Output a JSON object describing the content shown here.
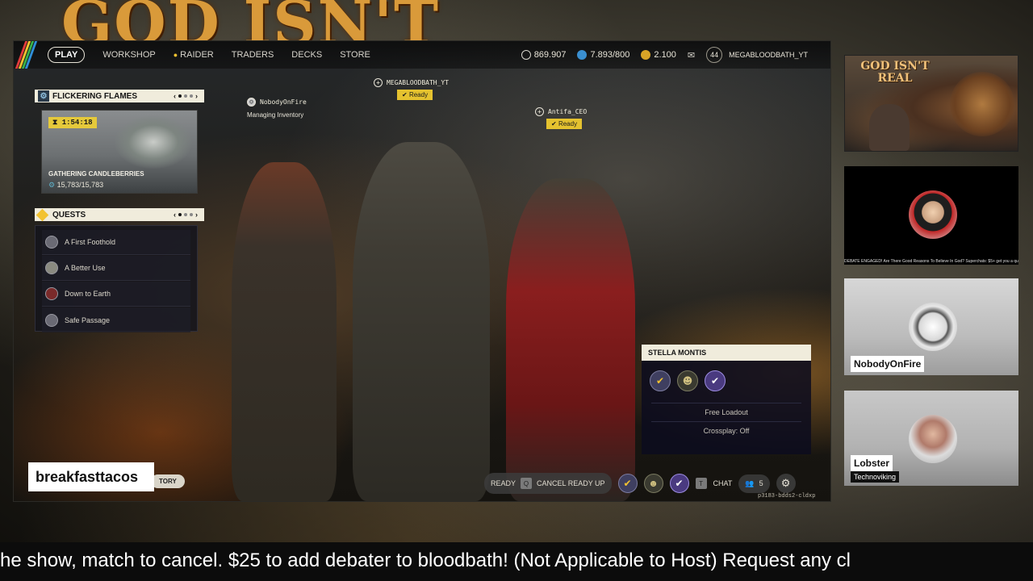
{
  "background": {
    "banner_text": "GOD ISN'T"
  },
  "game": {
    "nav": {
      "play": "PLAY",
      "workshop": "WORKSHOP",
      "raider": "RAIDER",
      "traders": "TRADERS",
      "decks": "DECKS",
      "store": "STORE"
    },
    "currencies": {
      "credits": "869.907",
      "tokens": "7.893/800",
      "coins": "2.100",
      "level": "44",
      "username": "MEGABLOODBATH_YT"
    },
    "project": {
      "header": "FLICKERING FLAMES",
      "timer": "1:54:18",
      "title": "GATHERING CANDLEBERRIES",
      "progress": "15,783/15,783"
    },
    "quests": {
      "header": "QUESTS",
      "items": [
        {
          "label": "A First Foothold"
        },
        {
          "label": "A Better Use"
        },
        {
          "label": "Down to Earth"
        },
        {
          "label": "Safe Passage"
        }
      ]
    },
    "players": [
      {
        "name": "NobodyOnFire",
        "status": "Managing Inventory"
      },
      {
        "name": "MEGABLOODBATH_YT",
        "ready": "Ready"
      },
      {
        "name": "Antifa_CEO",
        "ready": "Ready"
      }
    ],
    "squad": {
      "header": "STELLA MONTIS",
      "loadout": "Free Loadout",
      "crossplay": "Crossplay: Off"
    },
    "bottom": {
      "ready": "READY",
      "cancel_key": "Q",
      "cancel": "CANCEL READY UP",
      "chat_key": "T",
      "chat": "CHAT",
      "party_count": "5",
      "session_id": "p3183-bdds2-cldxp",
      "history": "TORY"
    }
  },
  "overlay": {
    "streamer_name": "breakfasttacos",
    "thumbnail_title": "GOD ISN'T REAL",
    "cam_ticker": "DEBATE ENGAGED! Are There Good Reasons To Believe In God? Superchats: $5+ get you a questi",
    "cams": [
      {
        "name": "NobodyOnFire"
      },
      {
        "name": "Lobster",
        "subtitle": "Technoviking"
      }
    ],
    "ticker_text": "he show, match to cancel. $25 to add debater to bloodbath! (Not Applicable to Host) Request any cl"
  },
  "colors": {
    "accent_yellow": "#e5c22f",
    "panel_cream": "#f0ecdc",
    "ticker_bg": "#0c0c0c"
  }
}
